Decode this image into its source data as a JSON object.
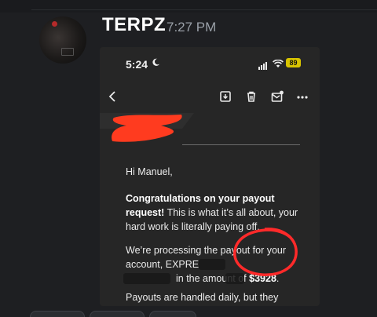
{
  "message": {
    "author": "TERPZ",
    "timestamp": "7:27 PM"
  },
  "phone": {
    "time": "5:24",
    "battery": "89"
  },
  "email": {
    "greeting": "Hi Manuel,",
    "p1_bold": "Congratulations on your payout request!",
    "p1_rest": " This is what it’s all about, your hard work is literally paying off.",
    "p2_a": "We’re processing the payout for your account, EXPRESS",
    "p2_b": "in the amount of",
    "amount": "$3928",
    "p2_end": ".",
    "p3": "Payouts are handled daily, but they"
  },
  "colors": {
    "redaction": "#ff3b1f",
    "circle": "#ff2a2a",
    "battery": "#d8c400"
  }
}
